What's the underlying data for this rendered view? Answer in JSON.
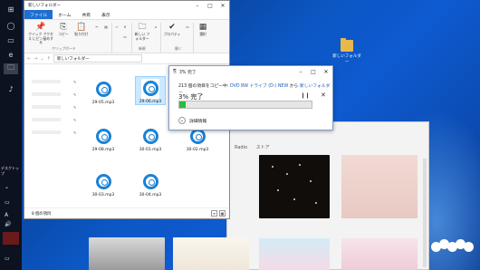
{
  "desktop": {
    "folder_label": "新しいフォルダー"
  },
  "taskbar": {
    "desktop_label": "デスクトップ",
    "tray_text": "A",
    "tray_vol": "🔊"
  },
  "explorer": {
    "title": "新しいフォルダー",
    "tabs": [
      "ファイル",
      "ホーム",
      "共有",
      "表示"
    ],
    "ribbon": {
      "quick_access": "クイック アクセス にピン留めする",
      "copy": "コピー",
      "paste": "貼り付け",
      "new_folder": "新しい フォルダー",
      "properties": "プロパティ",
      "select": "選択",
      "group_clipboard": "クリップボード",
      "group_new": "新規",
      "group_open": "開く"
    },
    "address": "新しいフォルダー",
    "files": [
      "29-05.mp3",
      "29-06.mp3",
      "29-07.mp3",
      "29-08.mp3",
      "30-01.mp3",
      "30-02.mp3",
      "30-03.mp3",
      "30-04.mp3"
    ],
    "selected_file": "29-06.mp3",
    "status": "8 個の項目"
  },
  "copy_dialog": {
    "title": "3% 完了",
    "line_prefix": "213 個の項目をコピー中:",
    "line_source": "DVD RW ドライブ (D:) NEW",
    "line_mid": "から",
    "line_dest": "新しいフォルダー",
    "percent_label": "3% 完了",
    "progress": 0.05,
    "details": "詳細情報"
  },
  "media": {
    "tabs": [
      "Radio",
      "ストア"
    ]
  }
}
